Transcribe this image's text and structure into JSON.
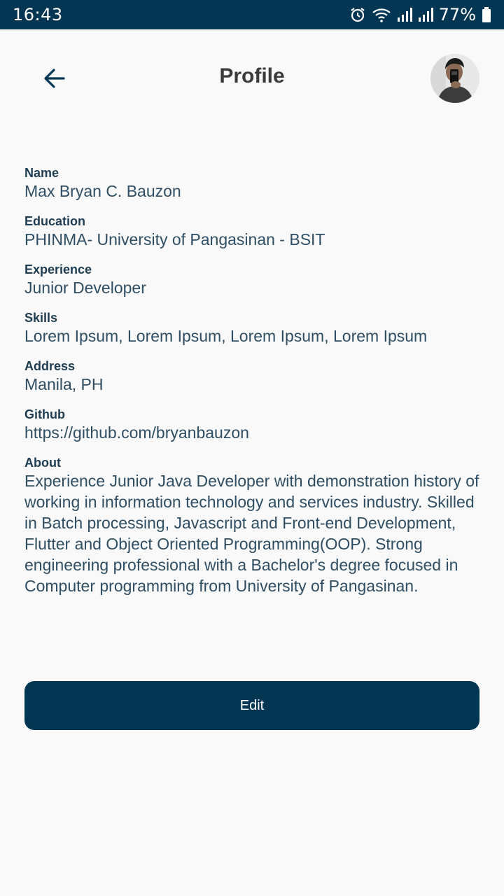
{
  "status_bar": {
    "time": "16:43",
    "battery": "77%",
    "icons": [
      "alarm-icon",
      "wifi-icon",
      "signal-icon",
      "signal-icon",
      "battery-icon"
    ]
  },
  "header": {
    "title": "Profile",
    "back_icon": "arrow-left-icon"
  },
  "profile": {
    "fields": [
      {
        "label": "Name",
        "value": "Max Bryan C. Bauzon"
      },
      {
        "label": "Education",
        "value": "PHINMA- University of Pangasinan - BSIT"
      },
      {
        "label": "Experience",
        "value": "Junior Developer"
      },
      {
        "label": "Skills",
        "value": "Lorem Ipsum, Lorem Ipsum, Lorem Ipsum, Lorem Ipsum"
      },
      {
        "label": "Address",
        "value": "Manila, PH"
      },
      {
        "label": "Github",
        "value": "https://github.com/bryanbauzon"
      }
    ],
    "about": {
      "label": "About",
      "value": "Experience Junior Java Developer with demonstration history of working in information technology and services industry. Skilled in Batch processing, Javascript and Front-end Development, Flutter and Object Oriented Programming(OOP). Strong engineering professional with a Bachelor's degree focused in Computer programming from University of Pangasinan."
    }
  },
  "actions": {
    "edit_label": "Edit"
  },
  "colors": {
    "primary": "#023653",
    "background": "#f9f9f9",
    "label": "#1f3d52",
    "value": "#2f4e63"
  }
}
